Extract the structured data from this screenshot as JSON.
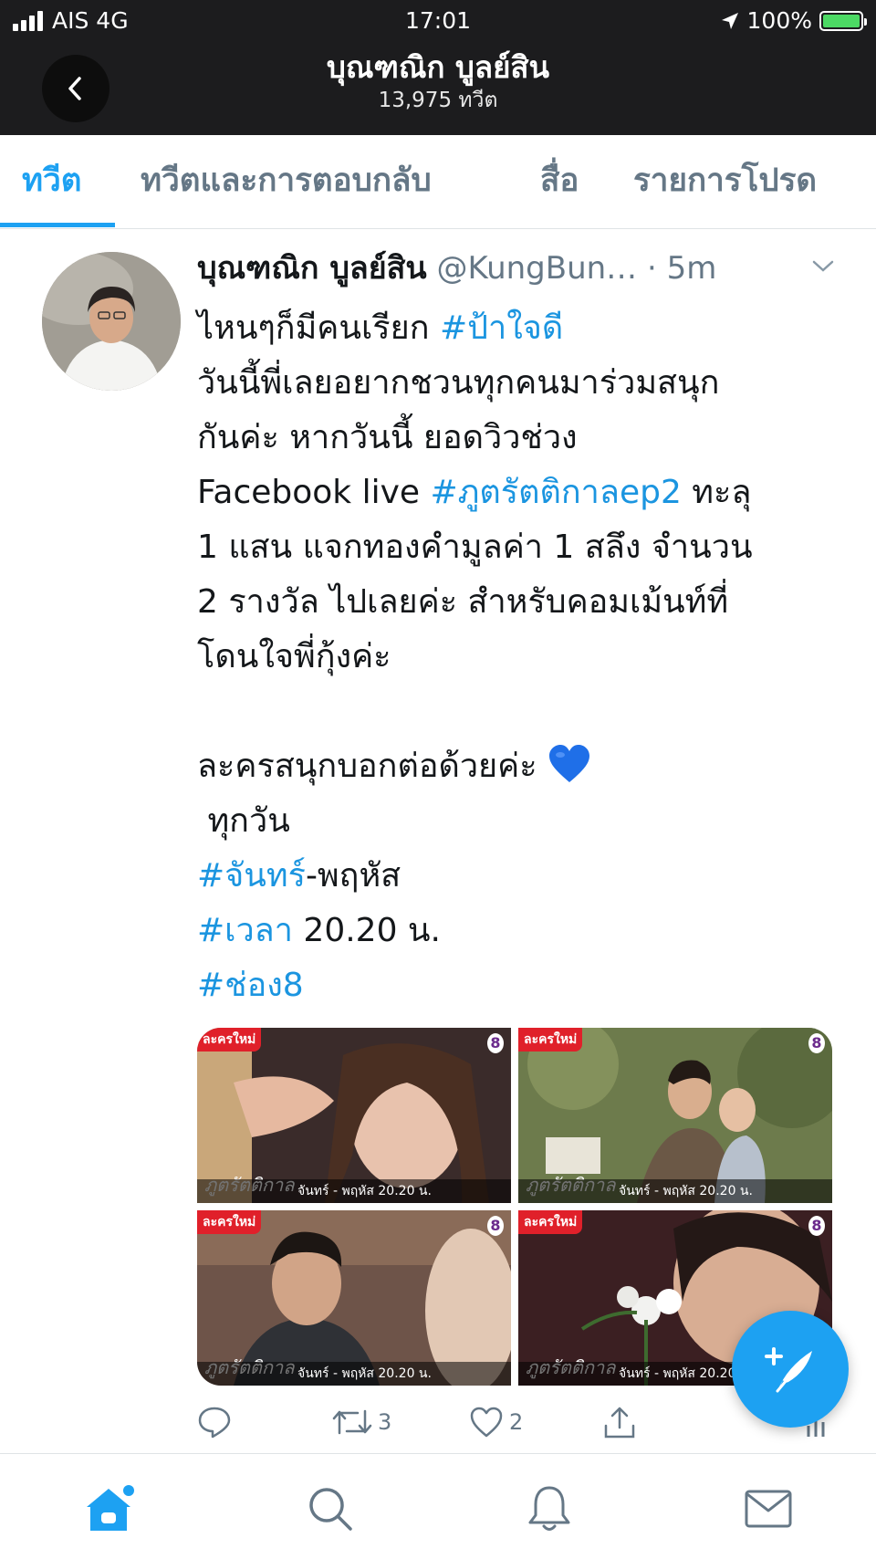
{
  "status_bar": {
    "carrier": "AIS 4G",
    "time": "17:01",
    "battery": "100%"
  },
  "header": {
    "title": "บุณฑณิก บูลย์สิน",
    "subtitle": "13,975 ทวีต"
  },
  "tabs": [
    {
      "label": "ทวีต"
    },
    {
      "label": "ทวีตและการตอบกลับ"
    },
    {
      "label": "สื่อ"
    },
    {
      "label": "รายการโปรด"
    }
  ],
  "tweet": {
    "author": "บุณฑณิก บูลย์สิน",
    "handle": "@KungBun…",
    "time": "· 5m",
    "lines": {
      "l1": "ไหนๆก็มีคนเรียก ",
      "l1_tag": "#ป้าใจดี",
      "l2": "วันนี้พี่เลยอยากชวนทุกคนมาร่วมสนุก",
      "l3": "กันค่ะ หากวันนี้ ยอดวิวช่วง",
      "l4_pre": "Facebook live ",
      "l4_tag": "#ภูตรัตติกาลep2",
      "l4_post": " ทะลุ",
      "l5": "1 แสน แจกทองคำมูลค่า 1 สลึง จำนวน",
      "l6": "2 รางวัล ไปเลยค่ะ สำหรับคอมเม้นท์ที่",
      "l7": "โดนใจพี่กุ้งค่ะ",
      "l8": "ละครสนุกบอกต่อด้วยค่ะ ",
      "l9": " ทุกวัน",
      "l10_tag": "#จันทร์",
      "l10_post": "-พฤหัส",
      "l11_tag": "#เวลา",
      "l11_post": " 20.20 น.",
      "l12_tag": "#ช่อง8"
    },
    "media": {
      "badge": "ละครใหม่",
      "channel": "8",
      "caption": "จันทร์ - พฤหัส 20.20 น.",
      "logo": "ภูตรัตติกาล"
    },
    "actions": {
      "retweets": "3",
      "likes": "2"
    }
  },
  "colors": {
    "accent": "#1da1f2",
    "header_bg": "#1c1c1e",
    "heart": "#1f6fe8"
  },
  "icons": {
    "back": "chevron-left-icon",
    "reply": "reply-icon",
    "retweet": "retweet-icon",
    "like": "heart-outline-icon",
    "share": "share-icon",
    "compose": "compose-icon",
    "home": "home-icon",
    "search": "search-icon",
    "notifications": "bell-icon",
    "messages": "mail-icon"
  }
}
